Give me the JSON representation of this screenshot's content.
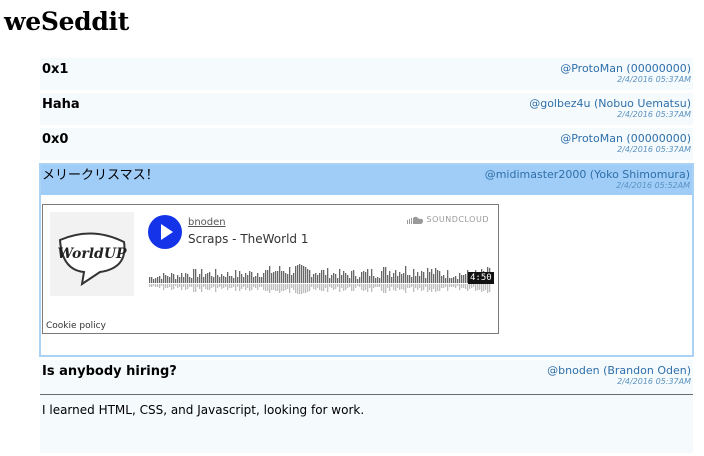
{
  "site": {
    "title": "weSeddit"
  },
  "posts": [
    {
      "title": "0x1",
      "author": "@ProtoMan (00000000)",
      "time": "2/4/2016 05:37AM"
    },
    {
      "title": "Haha",
      "author": "@golbez4u (Nobuo Uematsu)",
      "time": "2/4/2016 05:37AM"
    },
    {
      "title": "0x0",
      "author": "@ProtoMan (00000000)",
      "time": "2/4/2016 05:37AM"
    },
    {
      "title": "メリークリスマス！",
      "author": "@midimaster2000 (Yoko Shimomura)",
      "time": "2/4/2016 05:52AM",
      "embed": {
        "artist": "bnoden",
        "track": "Scraps - TheWorld 1",
        "brand": "SOUNDCLOUD",
        "duration": "4:50",
        "cookie": "Cookie policy",
        "artwork_text": "WorldUP",
        "played_fraction": 0.0,
        "accent_color": "#1533e8"
      }
    },
    {
      "title": "Is anybody hiring?",
      "author": "@bnoden (Brandon Oden)",
      "time": "2/4/2016 05:37AM",
      "body": "I learned HTML, CSS, and Javascript, looking for work."
    }
  ],
  "colors": {
    "link": "#2f6faa",
    "selected_header": "#9fcdf7",
    "post_bg": "#f5fafd"
  }
}
